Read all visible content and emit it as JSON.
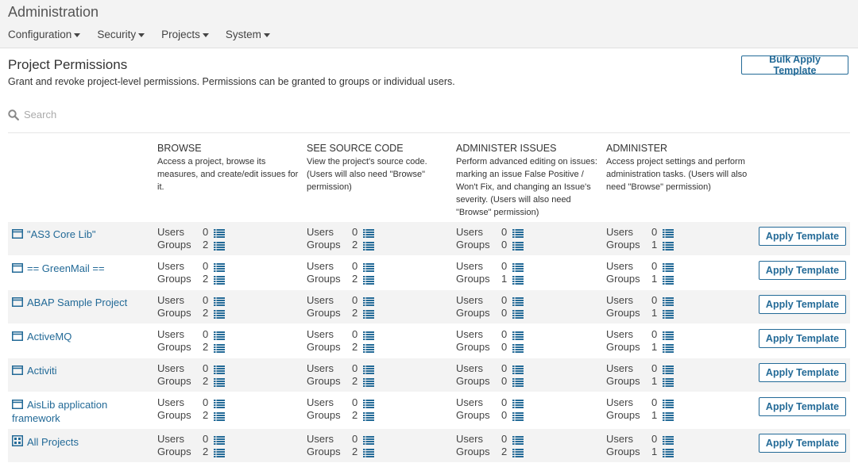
{
  "header": {
    "title": "Administration",
    "nav": [
      "Configuration",
      "Security",
      "Projects",
      "System"
    ]
  },
  "page": {
    "title": "Project Permissions",
    "description": "Grant and revoke project-level permissions. Permissions can be granted to groups or individual users.",
    "bulk_button": "Bulk Apply Template"
  },
  "search": {
    "placeholder": "Search"
  },
  "columns": [
    {
      "title": "BROWSE",
      "description": "Access a project, browse its measures, and create/edit issues for it."
    },
    {
      "title": "SEE SOURCE CODE",
      "description": "View the project's source code. (Users will also need \"Browse\" permission)"
    },
    {
      "title": "ADMINISTER ISSUES",
      "description": "Perform advanced editing on issues: marking an issue False Positive / Won't Fix, and changing an Issue's severity. (Users will also need \"Browse\" permission)"
    },
    {
      "title": "ADMINISTER",
      "description": "Access project settings and perform administration tasks. (Users will also need \"Browse\" permission)"
    }
  ],
  "labels": {
    "users": "Users",
    "groups": "Groups",
    "apply_button": "Apply Template"
  },
  "rows": [
    {
      "name": "\"AS3 Core Lib\"",
      "icon": "project-icon",
      "perms": [
        [
          0,
          2
        ],
        [
          0,
          2
        ],
        [
          0,
          0
        ],
        [
          0,
          1
        ]
      ]
    },
    {
      "name": "== GreenMail ==",
      "icon": "project-icon",
      "perms": [
        [
          0,
          2
        ],
        [
          0,
          2
        ],
        [
          0,
          1
        ],
        [
          0,
          1
        ]
      ]
    },
    {
      "name": "ABAP Sample Project",
      "icon": "project-icon",
      "perms": [
        [
          0,
          2
        ],
        [
          0,
          2
        ],
        [
          0,
          0
        ],
        [
          0,
          1
        ]
      ]
    },
    {
      "name": "ActiveMQ",
      "icon": "project-icon",
      "perms": [
        [
          0,
          2
        ],
        [
          0,
          2
        ],
        [
          0,
          0
        ],
        [
          0,
          1
        ]
      ]
    },
    {
      "name": "Activiti",
      "icon": "project-icon",
      "perms": [
        [
          0,
          2
        ],
        [
          0,
          2
        ],
        [
          0,
          0
        ],
        [
          0,
          1
        ]
      ]
    },
    {
      "name": "AisLib application framework",
      "icon": "project-icon",
      "perms": [
        [
          0,
          2
        ],
        [
          0,
          2
        ],
        [
          0,
          0
        ],
        [
          0,
          1
        ]
      ]
    },
    {
      "name": "All Projects",
      "icon": "all-projects-icon",
      "perms": [
        [
          0,
          2
        ],
        [
          0,
          2
        ],
        [
          0,
          2
        ],
        [
          0,
          1
        ]
      ]
    }
  ],
  "colors": {
    "link": "#236a97",
    "row_alt": "#f3f3f3"
  }
}
